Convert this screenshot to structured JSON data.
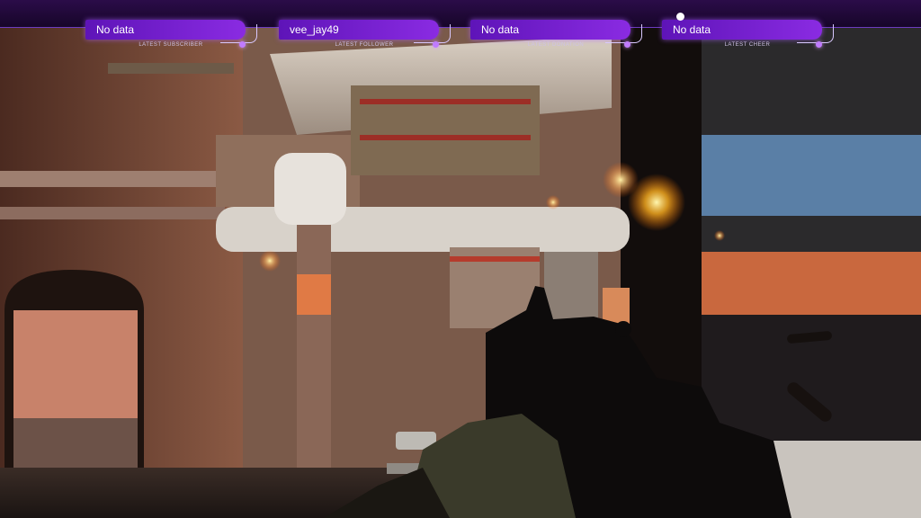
{
  "widgets": [
    {
      "value": "No data",
      "caption": "LATEST SUBSCRIBER"
    },
    {
      "value": "vee_jay49",
      "caption": "LATEST FOLLOWER"
    },
    {
      "value": "No data",
      "caption": "LATEST DONATION"
    },
    {
      "value": "No data",
      "caption": "LATEST CHEER"
    }
  ],
  "colors": {
    "accent": "#8a2be2",
    "bar": "#1f0836"
  },
  "icons": [
    "widget-dot-icon",
    "widget-bracket-icon"
  ]
}
